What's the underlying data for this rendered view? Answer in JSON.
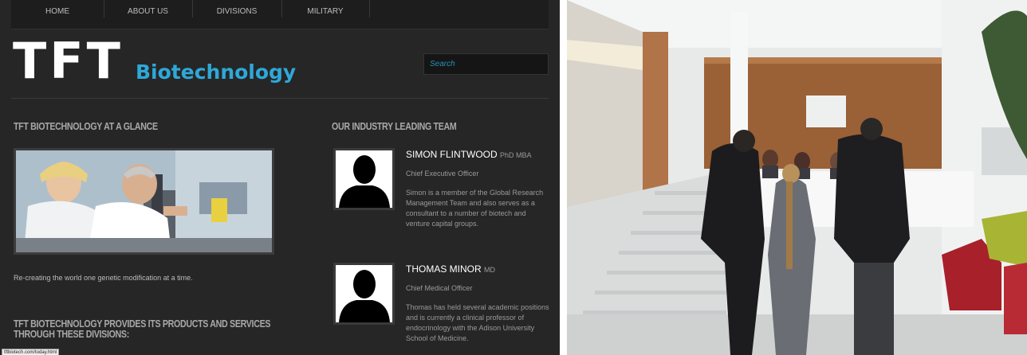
{
  "nav": {
    "items": [
      "HOME",
      "ABOUT US",
      "DIVISIONS",
      "MILITARY"
    ]
  },
  "logo": {
    "tft": "TFT",
    "biotech": "Biotechnology"
  },
  "search": {
    "placeholder": "Search"
  },
  "glance": {
    "heading": "TFT BIOTECHNOLOGY AT A GLANCE",
    "tagline": "Re-creating the world one genetic modification at a time."
  },
  "divisions": {
    "heading_line1": "TFT BIOTECHNOLOGY PROVIDES ITS PRODUCTS AND SERVICES",
    "heading_line2": "THROUGH THESE DIVISIONS:"
  },
  "team": {
    "heading": "OUR INDUSTRY LEADING TEAM",
    "members": [
      {
        "name": "SIMON FLINTWOOD",
        "credentials": "PhD MBA",
        "role": "Chief Executive Officer",
        "bio": "Simon is a member of the Global Research Management Team and also serves as a consultant to a number of biotech and venture capital groups."
      },
      {
        "name": "THOMAS MINOR",
        "credentials": "MD",
        "role": "Chief Medical Officer",
        "bio": "Thomas has held several academic positions and is currently a clinical professor of endocrinology with the Adison University School of Medicine."
      }
    ]
  },
  "status_bar": {
    "text": "tftbiotech.com/today.html"
  },
  "colors": {
    "background": "#262626",
    "accent": "#2ea8d8",
    "text_light": "#ffffff"
  },
  "icons": [
    "person-silhouette-icon"
  ]
}
